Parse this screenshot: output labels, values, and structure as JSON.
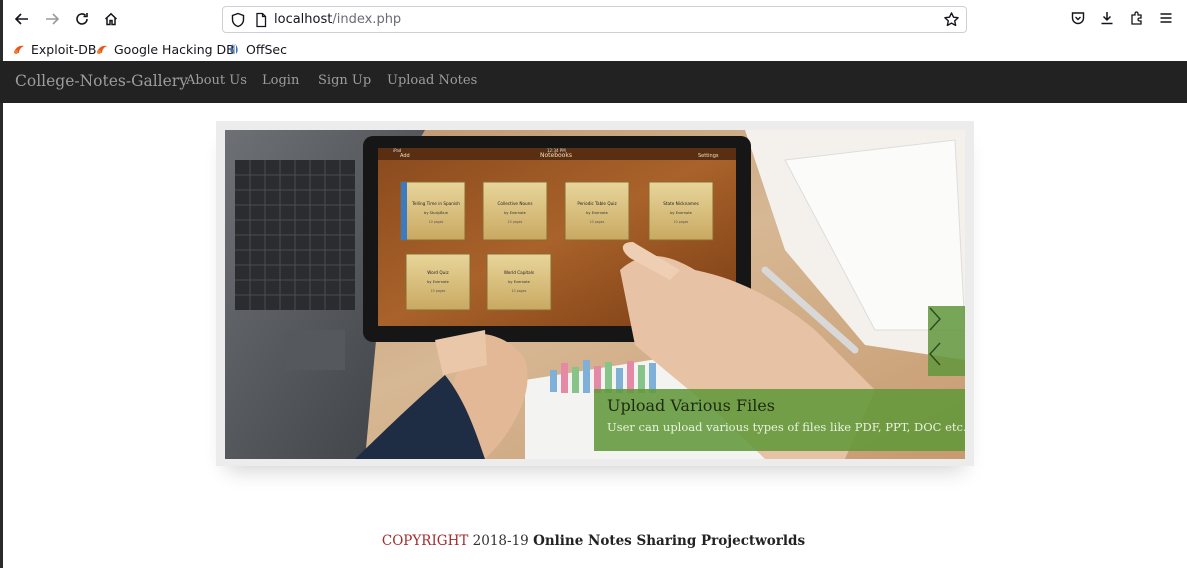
{
  "browser": {
    "url_host": "localhost",
    "url_path": "/index.php",
    "bookmarks": [
      {
        "label": "Exploit-DB",
        "icon": "exploit-db-icon"
      },
      {
        "label": "Google Hacking DB",
        "icon": "ghdb-icon"
      },
      {
        "label": "OffSec",
        "icon": "offsec-icon"
      }
    ]
  },
  "navbar": {
    "brand": "College-Notes-Gallery",
    "links": [
      "About Us",
      "Login",
      "Sign Up",
      "Upload Notes"
    ],
    "background": "#222222",
    "link_color": "#9d9d9d"
  },
  "carousel": {
    "caption_title": "Upload Various Files",
    "caption_text": "User can upload various types of files like PDF, PPT, DOC etc..",
    "accent": "#62983a",
    "tablet": {
      "status_left": "iPad",
      "status_time": "12:34 PM",
      "status_right": "",
      "nav_left": "Add",
      "nav_title": "Notebooks",
      "nav_right": "Settings",
      "notebooks": [
        {
          "title": "Telling Time in Spanish",
          "author": "by StudyBlue",
          "pages": "10 pages"
        },
        {
          "title": "Collective Nouns",
          "author": "by Evernote",
          "pages": "10 pages"
        },
        {
          "title": "Periodic Table Quiz",
          "author": "by Evernote",
          "pages": "10 pages"
        },
        {
          "title": "State Nicknames",
          "author": "by Evernote",
          "pages": "10 pages"
        },
        {
          "title": "Word Quiz",
          "author": "by Evernote",
          "pages": "10 pages"
        },
        {
          "title": "World Capitals",
          "author": "by Evernote",
          "pages": "10 pages"
        }
      ]
    }
  },
  "footer": {
    "copyright": "COPYRIGHT",
    "years": "2018-19",
    "owner": "Online Notes Sharing Projectworlds"
  }
}
